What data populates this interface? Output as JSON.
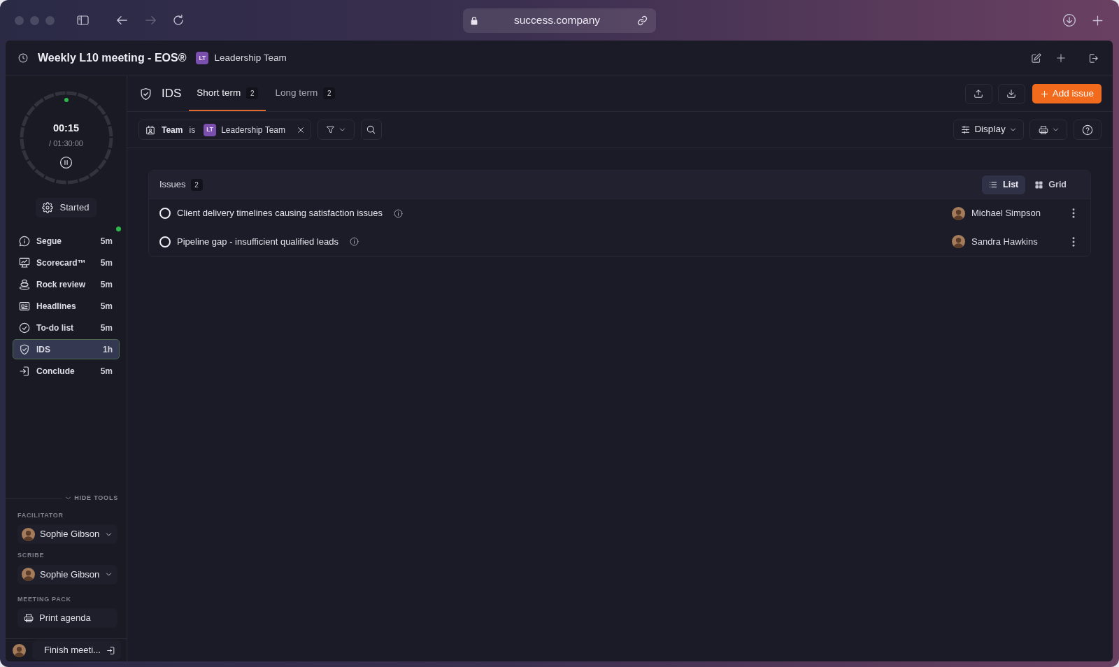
{
  "browser": {
    "url": "success.company",
    "back_disabled": false,
    "forward_disabled": true
  },
  "header": {
    "title": "Weekly L10 meeting - EOS®",
    "team": {
      "initials": "LT",
      "name": "Leadership Team"
    }
  },
  "sidebar": {
    "timer": {
      "elapsed": "00:15",
      "total": "/ 01:30:00"
    },
    "status": "Started",
    "agenda": [
      {
        "label": "Segue",
        "duration": "5m",
        "selected": false,
        "current": true
      },
      {
        "label": "Scorecard™",
        "duration": "5m",
        "selected": false,
        "current": false
      },
      {
        "label": "Rock review",
        "duration": "5m",
        "selected": false,
        "current": false
      },
      {
        "label": "Headlines",
        "duration": "5m",
        "selected": false,
        "current": false
      },
      {
        "label": "To-do list",
        "duration": "5m",
        "selected": false,
        "current": false
      },
      {
        "label": "IDS",
        "duration": "1h",
        "selected": true,
        "current": false
      },
      {
        "label": "Conclude",
        "duration": "5m",
        "selected": false,
        "current": false
      }
    ],
    "tools_toggle": "HIDE TOOLS",
    "facilitator": {
      "label": "FACILITATOR",
      "name": "Sophie Gibson"
    },
    "scribe": {
      "label": "SCRIBE",
      "name": "Sophie Gibson"
    },
    "meeting_pack": {
      "label": "MEETING PACK",
      "button": "Print agenda"
    },
    "finish_button": "Finish meeti..."
  },
  "section": {
    "title": "IDS",
    "tabs": [
      {
        "label": "Short term",
        "count": "2",
        "selected": true
      },
      {
        "label": "Long term",
        "count": "2",
        "selected": false
      }
    ],
    "add_button": "Add issue"
  },
  "filters": {
    "chip": {
      "field": "Team",
      "operator": "is",
      "team": {
        "initials": "LT",
        "name": "Leadership Team"
      }
    },
    "display_button": "Display"
  },
  "issues": {
    "title": "Issues",
    "count": "2",
    "views": [
      {
        "label": "List",
        "selected": true
      },
      {
        "label": "Grid",
        "selected": false
      }
    ],
    "rows": [
      {
        "title": "Client delivery timelines causing satisfaction issues",
        "checked": false,
        "owner": "Michael Simpson"
      },
      {
        "title": "Pipeline gap - insufficient qualified leads",
        "checked": false,
        "owner": "Sandra Hawkins"
      }
    ]
  }
}
